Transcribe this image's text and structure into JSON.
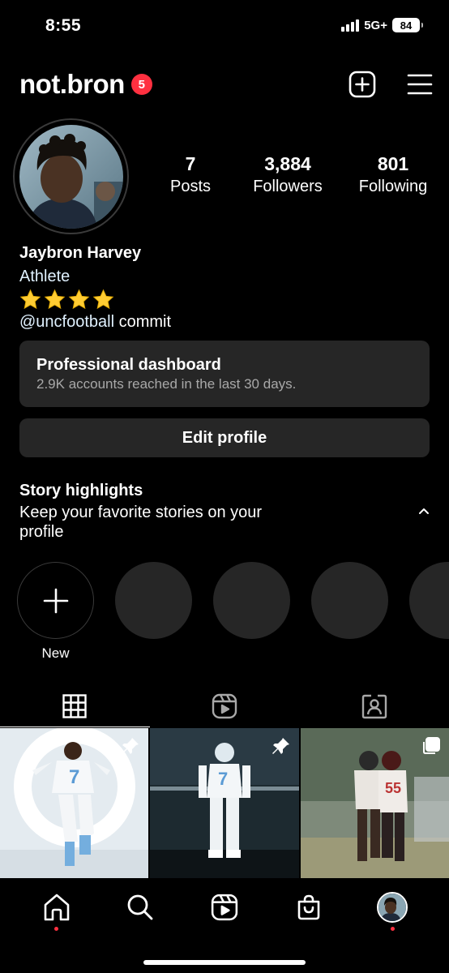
{
  "status_bar": {
    "time": "8:55",
    "network": "5G+",
    "battery": "84"
  },
  "header": {
    "username": "not.bron",
    "notification_count": "5"
  },
  "profile": {
    "stats": [
      {
        "value": "7",
        "label": "Posts"
      },
      {
        "value": "3,884",
        "label": "Followers"
      },
      {
        "value": "801",
        "label": "Following"
      }
    ],
    "name": "Jaybron Harvey",
    "category": "Athlete",
    "star_rating": 4,
    "bio_handle": "@uncfootball",
    "bio_text": " commit"
  },
  "dashboard": {
    "title": "Professional dashboard",
    "subtitle": "2.9K accounts reached in the last 30 days."
  },
  "edit_profile_label": "Edit profile",
  "highlights": {
    "title": "Story highlights",
    "subtitle": "Keep your favorite stories on your profile",
    "new_label": "New"
  },
  "colors": {
    "accent_red": "#ff3040",
    "surface": "#262626",
    "link": "#e0f1ff"
  },
  "icons": {
    "header": [
      "plus-square-icon",
      "menu-icon"
    ],
    "tabs": [
      "grid-icon",
      "reels-icon",
      "tagged-icon"
    ],
    "nav": [
      "home-icon",
      "search-icon",
      "reels-icon",
      "shop-icon",
      "profile-avatar"
    ]
  }
}
